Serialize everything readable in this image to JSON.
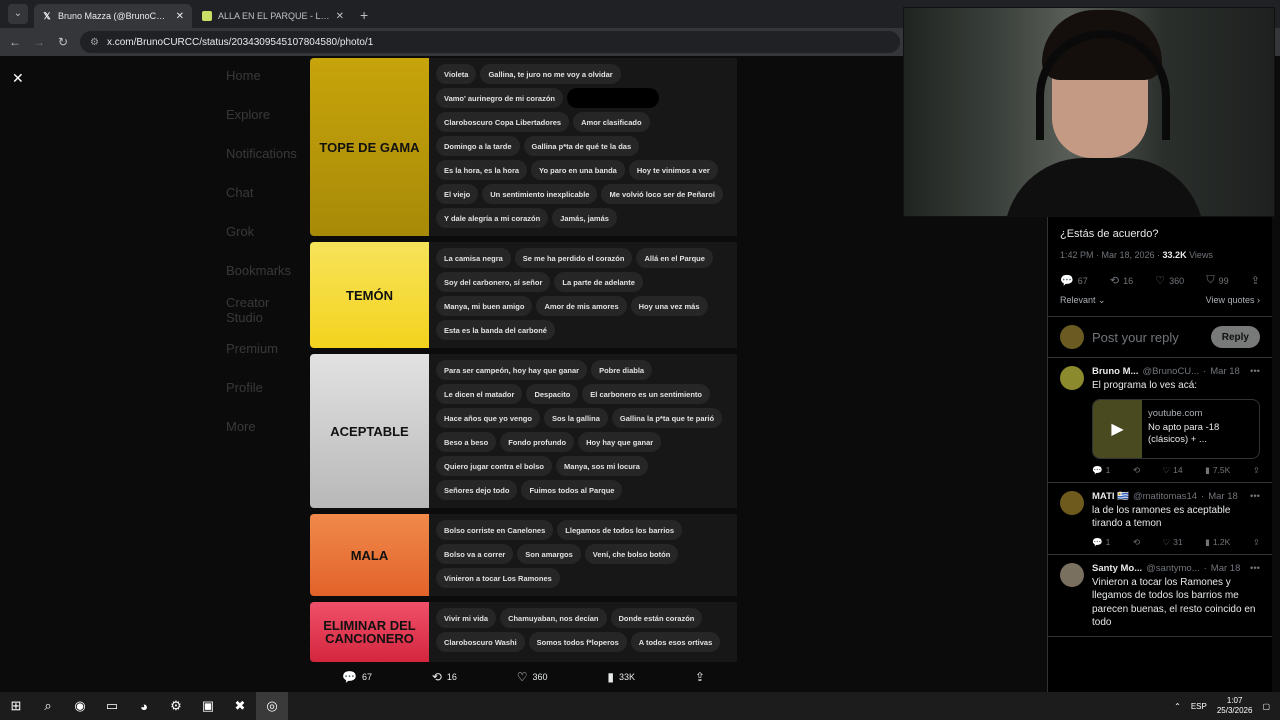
{
  "browser": {
    "tabs": [
      {
        "title": "Bruno Mazza (@BrunoCURCC)",
        "favicon": "x-logo-icon",
        "active": true
      },
      {
        "title": "ALLA EN EL PARQUE - La Banda",
        "favicon": "page-icon",
        "active": false
      }
    ],
    "url": "x.com/BrunoCURCC/status/2034309545107804580/photo/1"
  },
  "background_left_nav": [
    "Home",
    "Explore",
    "Notifications",
    "Chat",
    "Grok",
    "Bookmarks",
    "Creator Studio",
    "Premium",
    "Profile",
    "More"
  ],
  "tiers": [
    {
      "label": "TOPE DE GAMA",
      "color": "#c7a40b",
      "color2": "#a88a08",
      "items": [
        "Violeta",
        "Gallina, te juro no me voy a olvidar",
        "Vamo' aurinegro de mi corazón",
        "",
        "Claroboscuro Copa Libertadores",
        "Amor clasificado",
        "Domingo a la tarde",
        "Gallina p*ta de qué te la das",
        "Es la hora, es la hora",
        "Yo paro en una banda",
        "Hoy te vinimos a ver",
        "El viejo",
        "Un sentimiento inexplicable",
        "Me volvió loco ser de Peñarol",
        "Y dale alegría a mi corazón",
        "Jamás, jamás"
      ]
    },
    {
      "label": "TEMÓN",
      "color": "#f6e35a",
      "color2": "#f4d31e",
      "items": [
        "La camisa negra",
        "Se me ha perdido el corazón",
        "Allá en el Parque",
        "Soy del carbonero, sí señor",
        "La parte de adelante",
        "Manya, mi buen amigo",
        "Amor de mis amores",
        "Hoy una vez más",
        "Esta es la banda del carboné"
      ]
    },
    {
      "label": "ACEPTABLE",
      "color": "#e2e2e2",
      "color2": "#b8b8b8",
      "items": [
        "Para ser campeón, hoy hay que ganar",
        "Pobre diabla",
        "Le dicen el matador",
        "Despacito",
        "El carbonero es un sentimiento",
        "Hace años que yo vengo",
        "Sos la gallina",
        "Gallina la p*ta que te parió",
        "Beso a beso",
        "Fondo profundo",
        "Hoy hay que ganar",
        "Quiero jugar contra el bolso",
        "Manya, sos mi locura",
        "Señores dejo todo",
        "Fuimos todos al Parque"
      ]
    },
    {
      "label": "MALA",
      "color": "#f08a4b",
      "color2": "#e2622a",
      "items": [
        "Bolso corriste en Canelones",
        "Llegamos de todos los barrios",
        "Bolso va a correr",
        "Son amargos",
        "Vení, che bolso botón",
        "Vinieron a tocar Los Ramones"
      ]
    },
    {
      "label": "ELIMINAR DEL CANCIONERO",
      "color": "#f0506a",
      "color2": "#d4263e",
      "items": [
        "Vivir mi vida",
        "Chamuyaban, nos decían",
        "Donde están corazón",
        "Claroboscuro Washi",
        "Somos todos f*loperos",
        "A todos esos ortivas"
      ]
    }
  ],
  "photo_actions": {
    "replies": "67",
    "reposts": "16",
    "likes": "360",
    "views": "33K"
  },
  "post": {
    "text": "¿Estás de acuerdo?",
    "time": "1:42 PM · Mar 18, 2026 · ",
    "views_count": "33.2K",
    "views_label": "Views",
    "stats": {
      "replies": "67",
      "reposts": "16",
      "likes": "360",
      "bookmarks": "99"
    },
    "relevant": "Relevant",
    "view_quotes": "View quotes"
  },
  "reply_box": {
    "placeholder": "Post your reply",
    "button": "Reply"
  },
  "comments": [
    {
      "name": "Bruno M...",
      "handle": "@BrunoCU...",
      "date": "Mar 18",
      "text": "El programa lo ves acá:",
      "card": {
        "domain": "youtube.com",
        "title": "No apto para -18 (clásicos) + ..."
      },
      "replies": "1",
      "reposts": "",
      "likes": "14",
      "views": "7.5K"
    },
    {
      "name": "MATI 🇺🇾",
      "handle": "@matitomas14",
      "date": "Mar 18",
      "text": "la de los ramones es aceptable tirando a temon",
      "replies": "1",
      "reposts": "",
      "likes": "31",
      "views": "1.2K"
    },
    {
      "name": "Santy Mo...",
      "handle": "@santymo...",
      "date": "Mar 18",
      "text": "Vinieron a tocar los Ramones y llegamos de todos los barrios me parecen buenas, el resto coincido en todo"
    }
  ],
  "taskbar": {
    "lang": "ESP",
    "time": "1:07",
    "date": "25/3/2026"
  }
}
